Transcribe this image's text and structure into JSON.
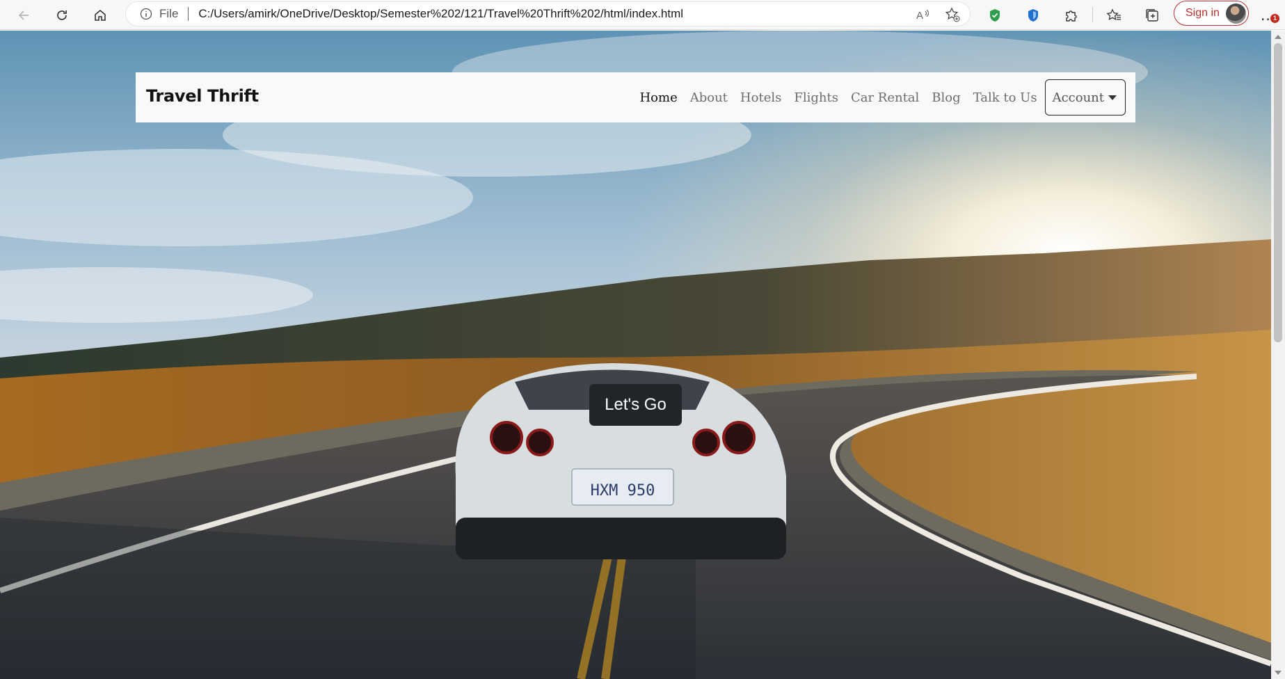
{
  "browser": {
    "address_prefix": "File",
    "url": "C:/Users/amirk/OneDrive/Desktop/Semester%202/121/Travel%20Thrift%202/html/index.html",
    "signin_label": "Sign in",
    "notification_badge": "1",
    "more_label": "..."
  },
  "navbar": {
    "brand": "Travel Thrift",
    "links": [
      {
        "label": "Home",
        "active": true
      },
      {
        "label": "About"
      },
      {
        "label": "Hotels"
      },
      {
        "label": "Flights"
      },
      {
        "label": "Car Rental"
      },
      {
        "label": "Blog"
      },
      {
        "label": "Talk to Us"
      }
    ],
    "account_label": "Account"
  },
  "hero": {
    "cta_label": "Let's Go",
    "plate_text": "HXM 950"
  },
  "colors": {
    "navbar_bg": "#f8f9fa",
    "cta_bg": "#212529",
    "signin_accent": "#c02a2a"
  }
}
